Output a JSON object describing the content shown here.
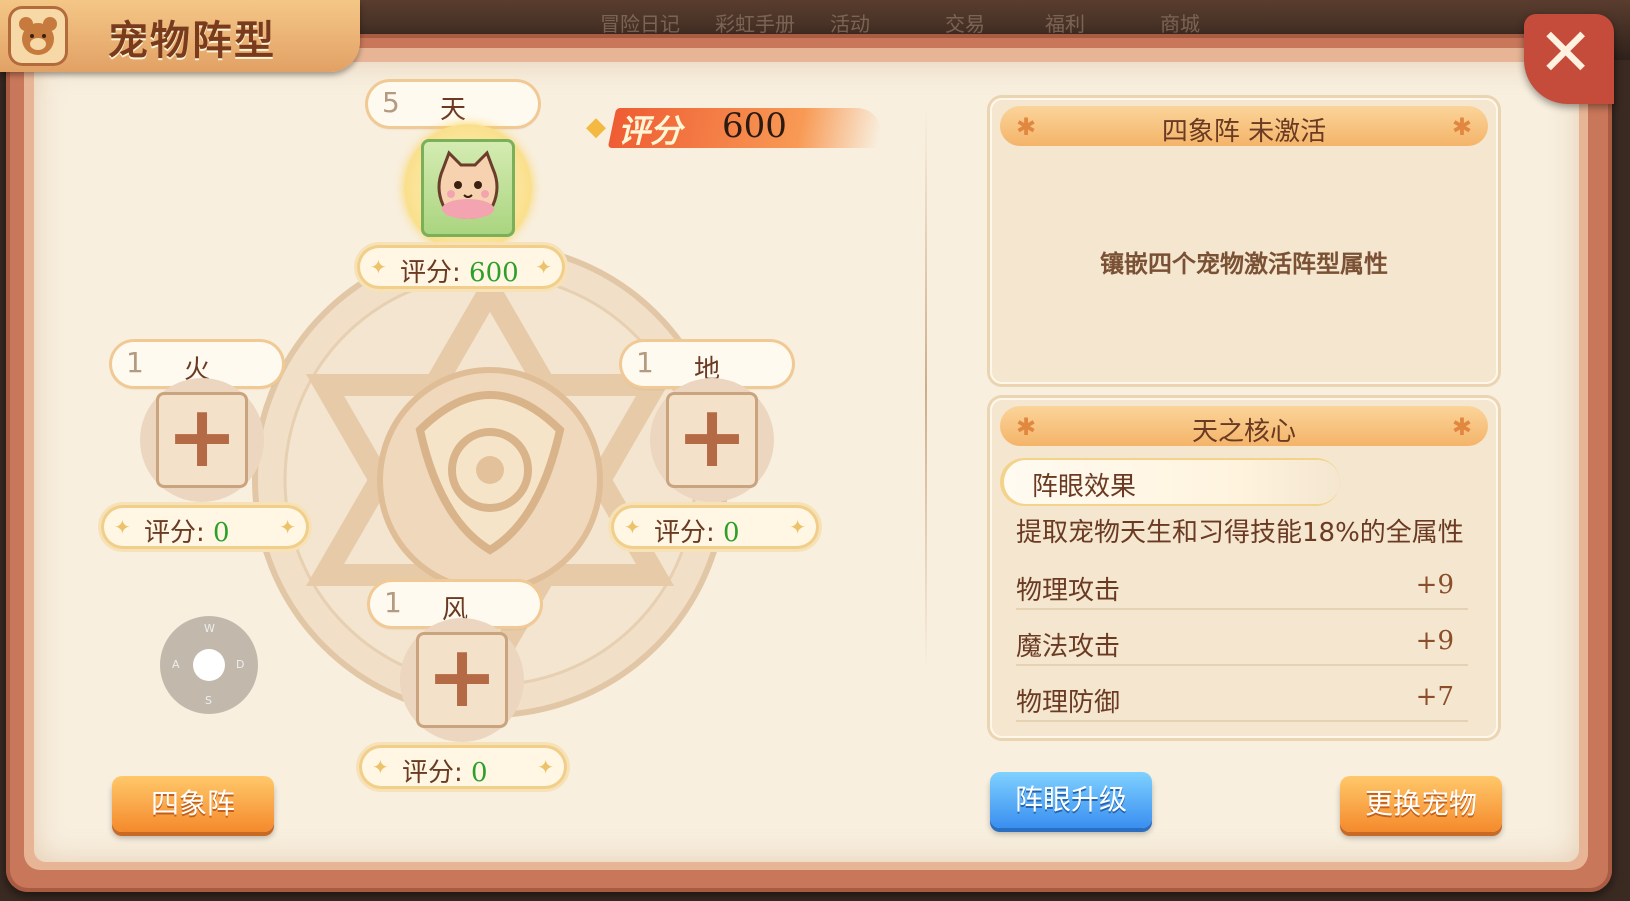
{
  "header": {
    "title": "宠物阵型",
    "background_menu": [
      "冒险日记",
      "彩虹手册",
      "活动",
      "交易",
      "福利",
      "商城"
    ]
  },
  "total_score": {
    "label": "评分",
    "value": "600"
  },
  "slots": {
    "tian": {
      "level": "5",
      "name": "天",
      "score_label": "评分:",
      "score": "600",
      "has_pet": true
    },
    "huo": {
      "level": "1",
      "name": "火",
      "score_label": "评分:",
      "score": "0",
      "add_symbol": "+"
    },
    "di": {
      "level": "1",
      "name": "地",
      "score_label": "评分:",
      "score": "0",
      "add_symbol": "+"
    },
    "feng": {
      "level": "1",
      "name": "风",
      "score_label": "评分:",
      "score": "0",
      "add_symbol": "+"
    }
  },
  "dpad": {
    "up": "W",
    "left": "A",
    "right": "D",
    "down": "S"
  },
  "formation_panel": {
    "title": "四象阵 未激活",
    "description": "镶嵌四个宠物激活阵型属性"
  },
  "core_panel": {
    "title": "天之核心",
    "effect_label": "阵眼效果",
    "effect_text": "提取宠物天生和习得技能18%的全属性",
    "stats": [
      {
        "name": "物理攻击",
        "value": "+9"
      },
      {
        "name": "魔法攻击",
        "value": "+9"
      },
      {
        "name": "物理防御",
        "value": "+7"
      }
    ]
  },
  "buttons": {
    "formation": "四象阵",
    "upgrade": "阵眼升级",
    "change_pet": "更换宠物"
  },
  "colors": {
    "accent": "#f48a2c",
    "blue": "#3a8ff0",
    "score_green": "#2ea02a",
    "frame": "#c9775a"
  }
}
